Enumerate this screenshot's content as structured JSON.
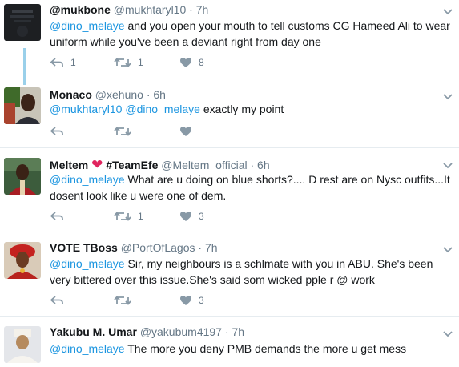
{
  "tweets": [
    {
      "name": "@mukbone",
      "handle": "@mukhtaryl10",
      "time": "7h",
      "mention": "@dino_melaye",
      "text_rest": " and you open your mouth to tell customs CG Hameed Ali to wear uniform while you've been a deviant right from day one",
      "replies": "1",
      "retweets": "1",
      "likes": "8"
    },
    {
      "name": "Monaco",
      "handle": "@xehuno",
      "time": "6h",
      "mention": "@mukhtaryl10 @dino_melaye",
      "text_rest": " exactly my point",
      "replies": "",
      "retweets": "",
      "likes": ""
    },
    {
      "name": "Meltem",
      "name_emoji": "heart",
      "name_tag": "#TeamEfe",
      "handle": "@Meltem_official",
      "time": "6h",
      "mention": "@dino_melaye",
      "text_rest": " What are u doing on blue shorts?.... D rest are on Nysc outfits...It dosent look like u were one of dem.",
      "replies": "",
      "retweets": "1",
      "likes": "3"
    },
    {
      "name": "VOTE TBoss",
      "handle": "@PortOfLagos",
      "time": "7h",
      "mention": "@dino_melaye",
      "text_rest": " Sir, my neighbours is a schlmate with you in ABU. She's been very bittered over this issue.She's said som wicked pple r @ work",
      "replies": "",
      "retweets": "",
      "likes": "3"
    },
    {
      "name": "Yakubu M. Umar",
      "handle": "@yakubum4197",
      "time": "7h",
      "mention": "@dino_melaye",
      "text_rest": " The more you deny PMB demands the more u get mess",
      "replies": "",
      "retweets": "",
      "likes": ""
    }
  ],
  "colors": {
    "link": "#1b95e0",
    "muted": "#657786",
    "text": "#14171a",
    "thread": "#9ad0ea",
    "heart": "#e0245e"
  },
  "icons": [
    "reply-icon",
    "retweet-icon",
    "like-icon",
    "chevron-down-icon"
  ]
}
